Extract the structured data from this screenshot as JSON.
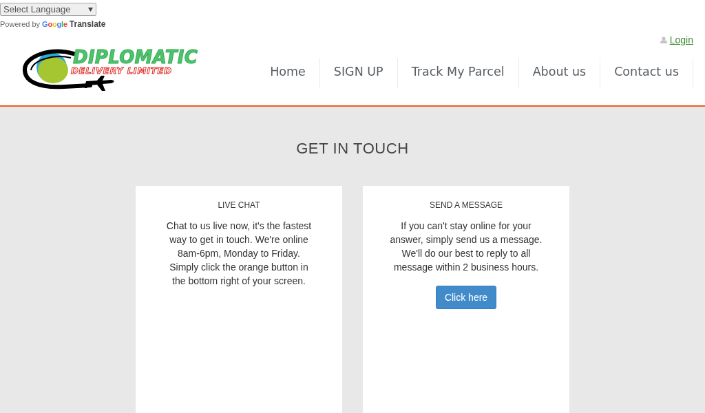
{
  "language_select": {
    "value": "Select Language"
  },
  "translate_credit": {
    "prefix": "Powered by",
    "brand": "Google",
    "suffix": "Translate"
  },
  "header": {
    "logo": {
      "title": "DIPLOMATIC",
      "subtitle": "DELIVERY LIMITED"
    },
    "login": "Login",
    "nav": [
      {
        "label": "Home"
      },
      {
        "label": "SIGN UP"
      },
      {
        "label": "Track My Parcel"
      },
      {
        "label": "About us"
      },
      {
        "label": "Contact us"
      }
    ]
  },
  "page_title": "GET IN TOUCH",
  "cards": [
    {
      "kind": "info",
      "title": "LIVE CHAT",
      "text": "Chat to us live now, it's the fastest way to get in touch. We're online 8am-6pm, Monday to Friday. Simply click the orange button in the bottom right of your screen."
    },
    {
      "kind": "action",
      "title": "SEND A MESSAGE",
      "text": "If you can't stay online for your answer, simply send us a message. We'll do our best to reply to all message within 2 business hours.",
      "button": "Click here"
    }
  ]
}
